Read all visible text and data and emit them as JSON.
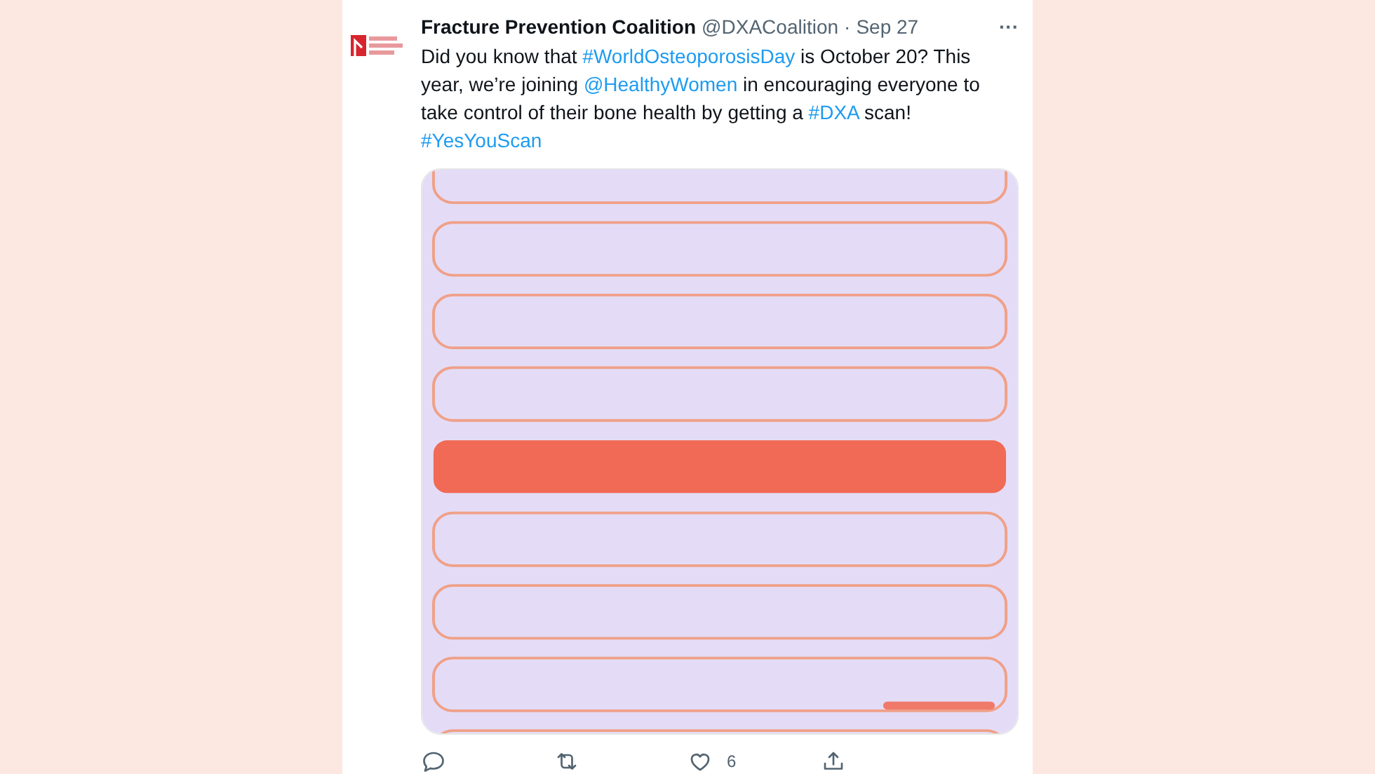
{
  "tweet": {
    "author": "Fracture Prevention Coalition",
    "handle": "@DXACoalition",
    "separator": "·",
    "date": "Sep 27",
    "more": "···",
    "body": [
      {
        "kind": "text",
        "text": "Did you know that "
      },
      {
        "kind": "link",
        "text": "#WorldOsteoporosisDay"
      },
      {
        "kind": "text",
        "text": " is October 20? This year, we’re joining "
      },
      {
        "kind": "link",
        "text": "@HealthyWomen"
      },
      {
        "kind": "text",
        "text": " in encouraging everyone to take control of their bone health by getting a "
      },
      {
        "kind": "link",
        "text": "#DXA"
      },
      {
        "kind": "text",
        "text": " scan! "
      },
      {
        "kind": "link",
        "text": "#YesYouScan"
      }
    ],
    "actions": [
      {
        "kind": "reply"
      },
      {
        "kind": "retweet"
      },
      {
        "kind": "like",
        "count": "6"
      },
      {
        "kind": "share"
      }
    ]
  }
}
